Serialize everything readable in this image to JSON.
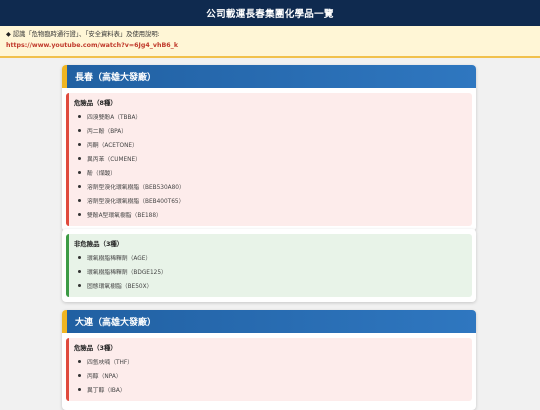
{
  "header": {
    "title": "公司載運長春集團化學品一覽"
  },
  "notice": {
    "text": "認識「危物臨時通行證」、「安全資料表」及使用說明:",
    "link": "https://www.youtube.com/watch?v=6Jg4_vhB6_k"
  },
  "plants": [
    {
      "name": "長春（高雄大發廠）",
      "hazardous": {
        "title": "危險品（8種）",
        "items": [
          "四溴雙酚A（TBBA）",
          "丙二酚（BPA）",
          "丙酮（ACETONE）",
          "異丙苯（CUMENE）",
          "酚（煤酸）",
          "溶劑型溴化環氧樹脂（BEB530A80）",
          "溶劑型溴化環氧樹脂（BEB400T65）",
          "雙酚A型環氧樹脂（BE188）"
        ]
      },
      "non_hazardous": {
        "title": "非危險品（3種）",
        "items": [
          "環氧樹脂稀釋劑（AGE）",
          "環氧樹脂稀釋劑（BDGE125）",
          "固態環氧樹脂（BE50X）"
        ]
      }
    },
    {
      "name": "大連（高雄大發廠）",
      "hazardous": {
        "title": "危險品（3種）",
        "items": [
          "四氫呋喃（THF）",
          "丙醇（NPA）",
          "異丁醇（IBA）"
        ]
      }
    }
  ]
}
